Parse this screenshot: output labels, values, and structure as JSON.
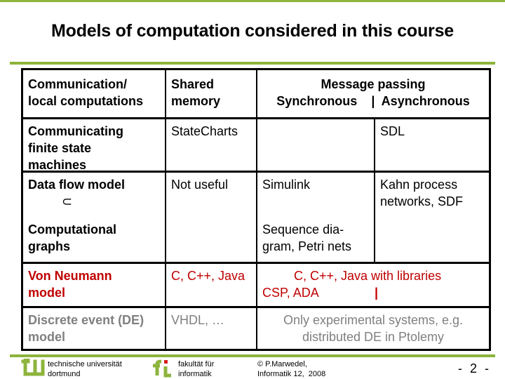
{
  "slide": {
    "title": "Models of computation considered in this course"
  },
  "table": {
    "header": {
      "col1": [
        "Communication/",
        "local computations"
      ],
      "col2": [
        "Shared",
        "memory"
      ],
      "col3_title": "Message passing",
      "col3_sub": "Synchronous    |  Asynchronous"
    },
    "rows": {
      "cfsm": {
        "label": [
          "Communicating",
          "finite state",
          "machines"
        ],
        "shared": "StateCharts",
        "sync": "",
        "async": "SDL"
      },
      "dataflow": {
        "label": "Data flow model",
        "subset_symbol": "⊂",
        "shared": "Not useful",
        "sync": "Simulink",
        "async": [
          "Kahn process",
          "networks, SDF"
        ]
      },
      "compgraphs": {
        "label": [
          "Computational",
          "graphs"
        ],
        "shared": "",
        "sync": [
          "Sequence dia-",
          "gram, Petri nets"
        ],
        "async": ""
      },
      "vonneumann": {
        "label": [
          "Von Neumann",
          "model"
        ],
        "shared": "C, C++, Java",
        "msg_line1": "C, C++, Java with libraries",
        "msg_line2": "CSP, ADA",
        "msg_separator": "|"
      },
      "de": {
        "label": [
          "Discrete event (DE)",
          "model"
        ],
        "shared": "VHDL, …",
        "msg": [
          "Only experimental systems, e.g.",
          "distributed DE in Ptolemy"
        ]
      }
    }
  },
  "colors": {
    "accent_green": "#8db43c",
    "highlight_red": "#c00000",
    "muted_gray": "#808080"
  },
  "footer": {
    "university": [
      "technische universität",
      "dortmund"
    ],
    "faculty": [
      "fakultät für",
      "informatik"
    ],
    "copyright": [
      "© P.Marwedel,",
      "Informatik 12,  2008"
    ],
    "page_number": "- 2 -"
  }
}
